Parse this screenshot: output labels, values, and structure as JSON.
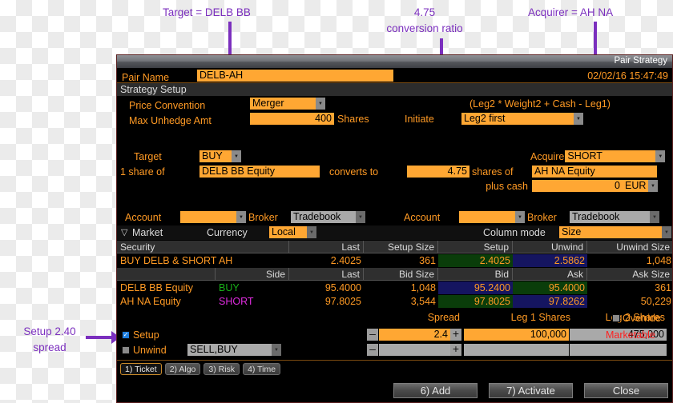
{
  "annotations": [
    {
      "id": "target",
      "text_line1": "Target = DELB BB",
      "text_line2": ""
    },
    {
      "id": "ratio",
      "text_line1": "4.75",
      "text_line2": "conversion ratio"
    },
    {
      "id": "acquirer",
      "text_line1": "Acquirer = AH NA",
      "text_line2": ""
    },
    {
      "id": "spread",
      "text_line1": "Setup 2.40",
      "text_line2": "spread"
    }
  ],
  "window": {
    "title": "Pair Strategy",
    "pair_name_label": "Pair Name",
    "pair_name_value": "DELB-AH",
    "timestamp": "02/02/16 15:47:49",
    "section_title": "Strategy Setup"
  },
  "setup": {
    "price_convention_label": "Price Convention",
    "price_convention_value": "Merger",
    "formula": "(Leg2 * Weight2 + Cash - Leg1)",
    "max_unhedge_label": "Max Unhedge Amt",
    "max_unhedge_value": "400",
    "max_unhedge_units": "Shares",
    "initiate_label": "Initiate",
    "initiate_value": "Leg2 first"
  },
  "conversion": {
    "target_label": "Target",
    "target_side": "BUY",
    "one_share_of": "1 share of",
    "target_security": "DELB BB Equity",
    "converts_to": "converts to",
    "ratio": "4.75",
    "shares_of": "shares of",
    "acquire_label": "Acquire",
    "acquire_side": "SHORT",
    "acquire_security": "AH NA Equity",
    "plus_cash_label": "plus cash",
    "cash_value": "0",
    "cash_currency": "EUR"
  },
  "accounts": {
    "leg1_account_label": "Account",
    "leg1_account_value": "",
    "leg1_broker_label": "Broker",
    "leg1_broker_value": "Tradebook",
    "leg2_account_label": "Account",
    "leg2_account_value": "",
    "leg2_broker_label": "Broker",
    "leg2_broker_value": "Tradebook"
  },
  "market_bar": {
    "market_label": "Market",
    "currency_label": "Currency",
    "currency_value": "Local",
    "column_mode_label": "Column mode",
    "column_mode_value": "Size"
  },
  "pair_table": {
    "headers": [
      "Security",
      "Last",
      "Setup Size",
      "Setup",
      "Unwind",
      "Unwind Size"
    ],
    "row": {
      "security": "BUY DELB & SHORT AH",
      "last": "2.4025",
      "setup_size": "361",
      "setup": "2.4025",
      "unwind": "2.5862",
      "unwind_size": "1,048"
    }
  },
  "leg_table": {
    "headers": [
      "",
      "Side",
      "Last",
      "Bid Size",
      "Bid",
      "Ask",
      "Ask Size"
    ],
    "rows": [
      {
        "security": "DELB BB Equity",
        "side": "BUY",
        "side_color": "#18b018",
        "last": "95.4000",
        "bid_size": "1,048",
        "bid": "95.2400",
        "ask": "95.4000",
        "ask_size": "361"
      },
      {
        "security": "AH NA Equity",
        "side": "SHORT",
        "side_color": "#e02ce0",
        "last": "97.8025",
        "bid_size": "3,544",
        "bid": "97.8025",
        "ask": "97.8262",
        "ask_size": "50,229"
      }
    ]
  },
  "order_panel": {
    "headers": {
      "spread": "Spread",
      "leg1_shares": "Leg 1 Shares",
      "leg2_shares": "Leg 2 Shares",
      "override": "Override"
    },
    "setup_row": {
      "label": "Setup",
      "checked": true,
      "minus": "–",
      "spread": "2.4",
      "plus": "+",
      "leg1_shares": "100,000",
      "leg2_shares": "475,000",
      "status": "Marketable"
    },
    "unwind_row": {
      "label": "Unwind",
      "checked": false,
      "side": "SELL,BUY",
      "minus": "–",
      "spread": "",
      "plus": "+",
      "leg1_shares": "",
      "leg2_shares": "",
      "status": ""
    }
  },
  "footer": {
    "tabs": [
      {
        "label": "1) Ticket",
        "selected": true
      },
      {
        "label": "2) Algo",
        "selected": false
      },
      {
        "label": "3) Risk",
        "selected": false
      },
      {
        "label": "4) Time",
        "selected": false
      }
    ],
    "buttons": [
      {
        "label": "6) Add"
      },
      {
        "label": "7) Activate"
      },
      {
        "label": "Close"
      }
    ]
  },
  "colors": {
    "orange": "#ff9a24",
    "field_orange": "#ffa733",
    "purple": "#7b2fbe",
    "red": "#ff2020",
    "green_cell": "#0a3d0a",
    "blue_cell": "#151560"
  }
}
